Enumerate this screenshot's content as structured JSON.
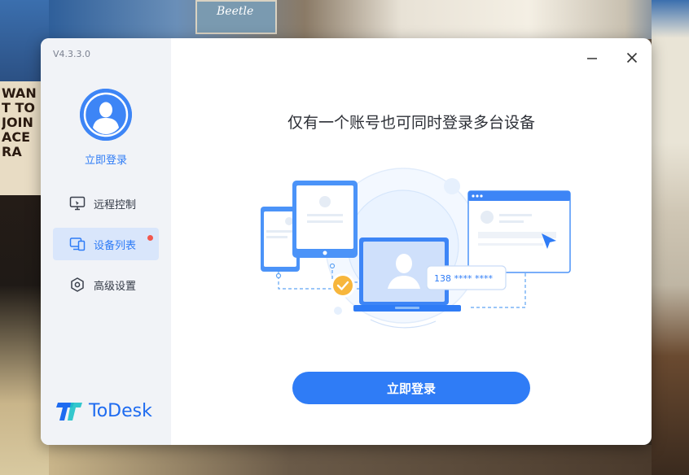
{
  "app": {
    "version": "V4.3.3.0",
    "brand": "ToDesk",
    "accent": "#2f7cf6"
  },
  "sidebar": {
    "login_link": "立即登录",
    "items": [
      {
        "label": "远程控制",
        "icon": "monitor-icon",
        "active": false
      },
      {
        "label": "设备列表",
        "icon": "devices-icon",
        "active": true,
        "badge": "red-dot"
      },
      {
        "label": "高级设置",
        "icon": "settings-hexagon-icon",
        "active": false
      }
    ]
  },
  "main": {
    "headline": "仅有一个账号也可同时登录多台设备",
    "illustration_phone_text": "138 **** ****",
    "login_button": "立即登录"
  },
  "window_controls": {
    "minimize_icon": "minimize-icon",
    "close_icon": "close-icon"
  },
  "wallpaper": {
    "card_text": "Beetle",
    "poster_text": "WANT TO JOIN ACE RA"
  }
}
